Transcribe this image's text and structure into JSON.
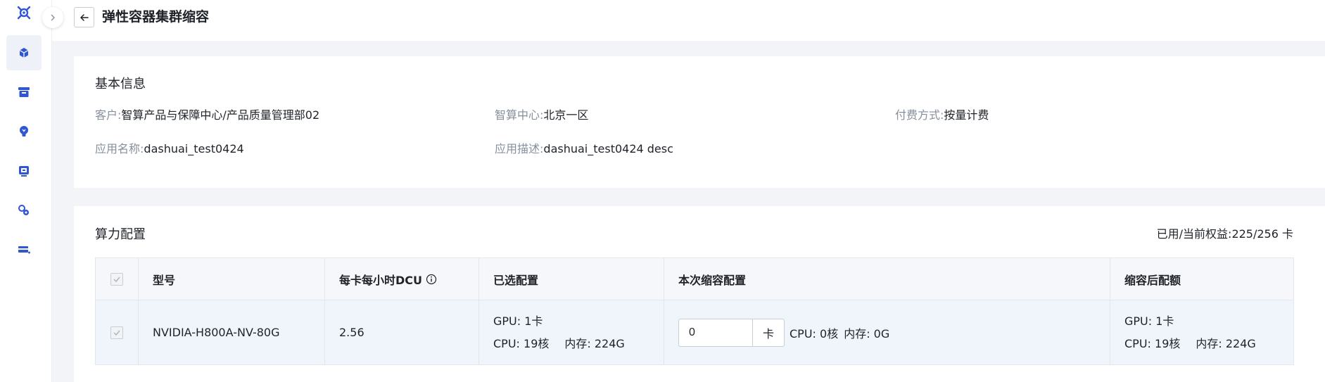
{
  "page": {
    "title": "弹性容器集群缩容"
  },
  "basic_info": {
    "title": "基本信息",
    "customer": {
      "label": "客户:",
      "value": "智算产品与保障中心/产品质量管理部02"
    },
    "center": {
      "label": "智算中心:",
      "value": "北京一区"
    },
    "billing": {
      "label": "付费方式:",
      "value": "按量计费"
    },
    "app_name": {
      "label": "应用名称:",
      "value": "dashuai_test0424"
    },
    "app_desc": {
      "label": "应用描述:",
      "value": "dashuai_test0424 desc"
    }
  },
  "compute": {
    "title": "算力配置",
    "quota": "已用/当前权益:225/256 卡",
    "columns": {
      "model": "型号",
      "dcu": "每卡每小时DCU",
      "selected": "已选配置",
      "scale": "本次缩容配置",
      "after": "缩容后配额"
    },
    "row": {
      "checked": true,
      "model": "NVIDIA-H800A-NV-80G",
      "dcu": "2.56",
      "selected_gpu": "GPU: 1卡",
      "selected_cpu": "CPU: 19核",
      "selected_mem": "内存: 224G",
      "scale_value": "0",
      "scale_unit": "卡",
      "scale_cpu": "CPU: 0核",
      "scale_mem": "内存: 0G",
      "after_gpu": "GPU: 1卡",
      "after_cpu": "CPU: 19核",
      "after_mem": "内存: 224G"
    }
  },
  "sidebar": {
    "items": [
      {
        "icon": "cube-icon",
        "active": true
      },
      {
        "icon": "archive-icon",
        "active": false
      },
      {
        "icon": "lightbulb-icon",
        "active": false
      },
      {
        "icon": "monitor-chip-icon",
        "active": false
      },
      {
        "icon": "gear-cluster-icon",
        "active": false
      },
      {
        "icon": "card-plus-icon",
        "active": false
      }
    ]
  },
  "colors": {
    "accent": "#3156d3",
    "muted_text": "#86909c",
    "page_bg": "#f2f4f7"
  }
}
